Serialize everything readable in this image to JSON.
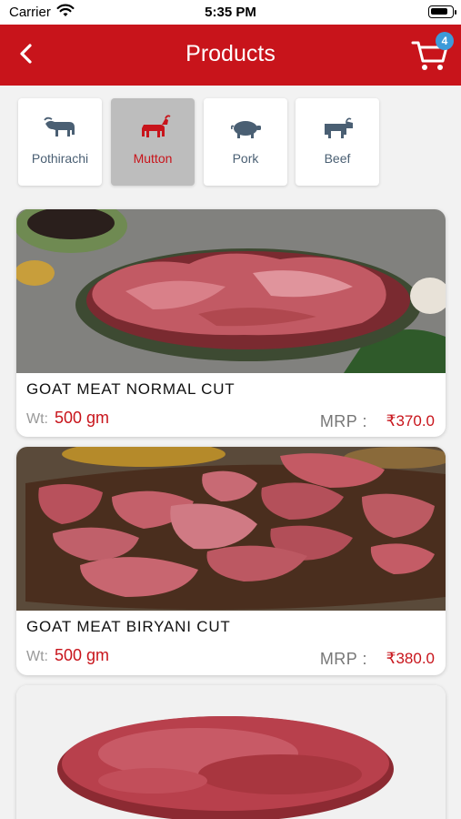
{
  "status_bar": {
    "carrier": "Carrier",
    "time": "5:35 PM",
    "battery_level": 0.85
  },
  "header": {
    "title": "Products",
    "cart_count": "4"
  },
  "categories": [
    {
      "label": "Pothirachi",
      "icon": "buffalo-icon",
      "selected": false
    },
    {
      "label": "Mutton",
      "icon": "goat-icon",
      "selected": true
    },
    {
      "label": "Pork",
      "icon": "pig-icon",
      "selected": false
    },
    {
      "label": "Beef",
      "icon": "cow-icon",
      "selected": false
    }
  ],
  "products": [
    {
      "name": "GOAT MEAT NORMAL CUT",
      "weight_label": "Wt:",
      "weight": "500 gm",
      "mrp_label": "MRP :",
      "price": "₹370.0"
    },
    {
      "name": "GOAT MEAT BIRYANI CUT",
      "weight_label": "Wt:",
      "weight": "500 gm",
      "mrp_label": "MRP :",
      "price": "₹380.0"
    },
    {
      "name": "",
      "weight_label": "",
      "weight": "",
      "mrp_label": "",
      "price": ""
    }
  ],
  "colors": {
    "brand_red": "#c8141b",
    "badge_blue": "#3d9ad9",
    "icon_slate": "#4a5f73",
    "selected_tile": "#bdbdbd"
  }
}
